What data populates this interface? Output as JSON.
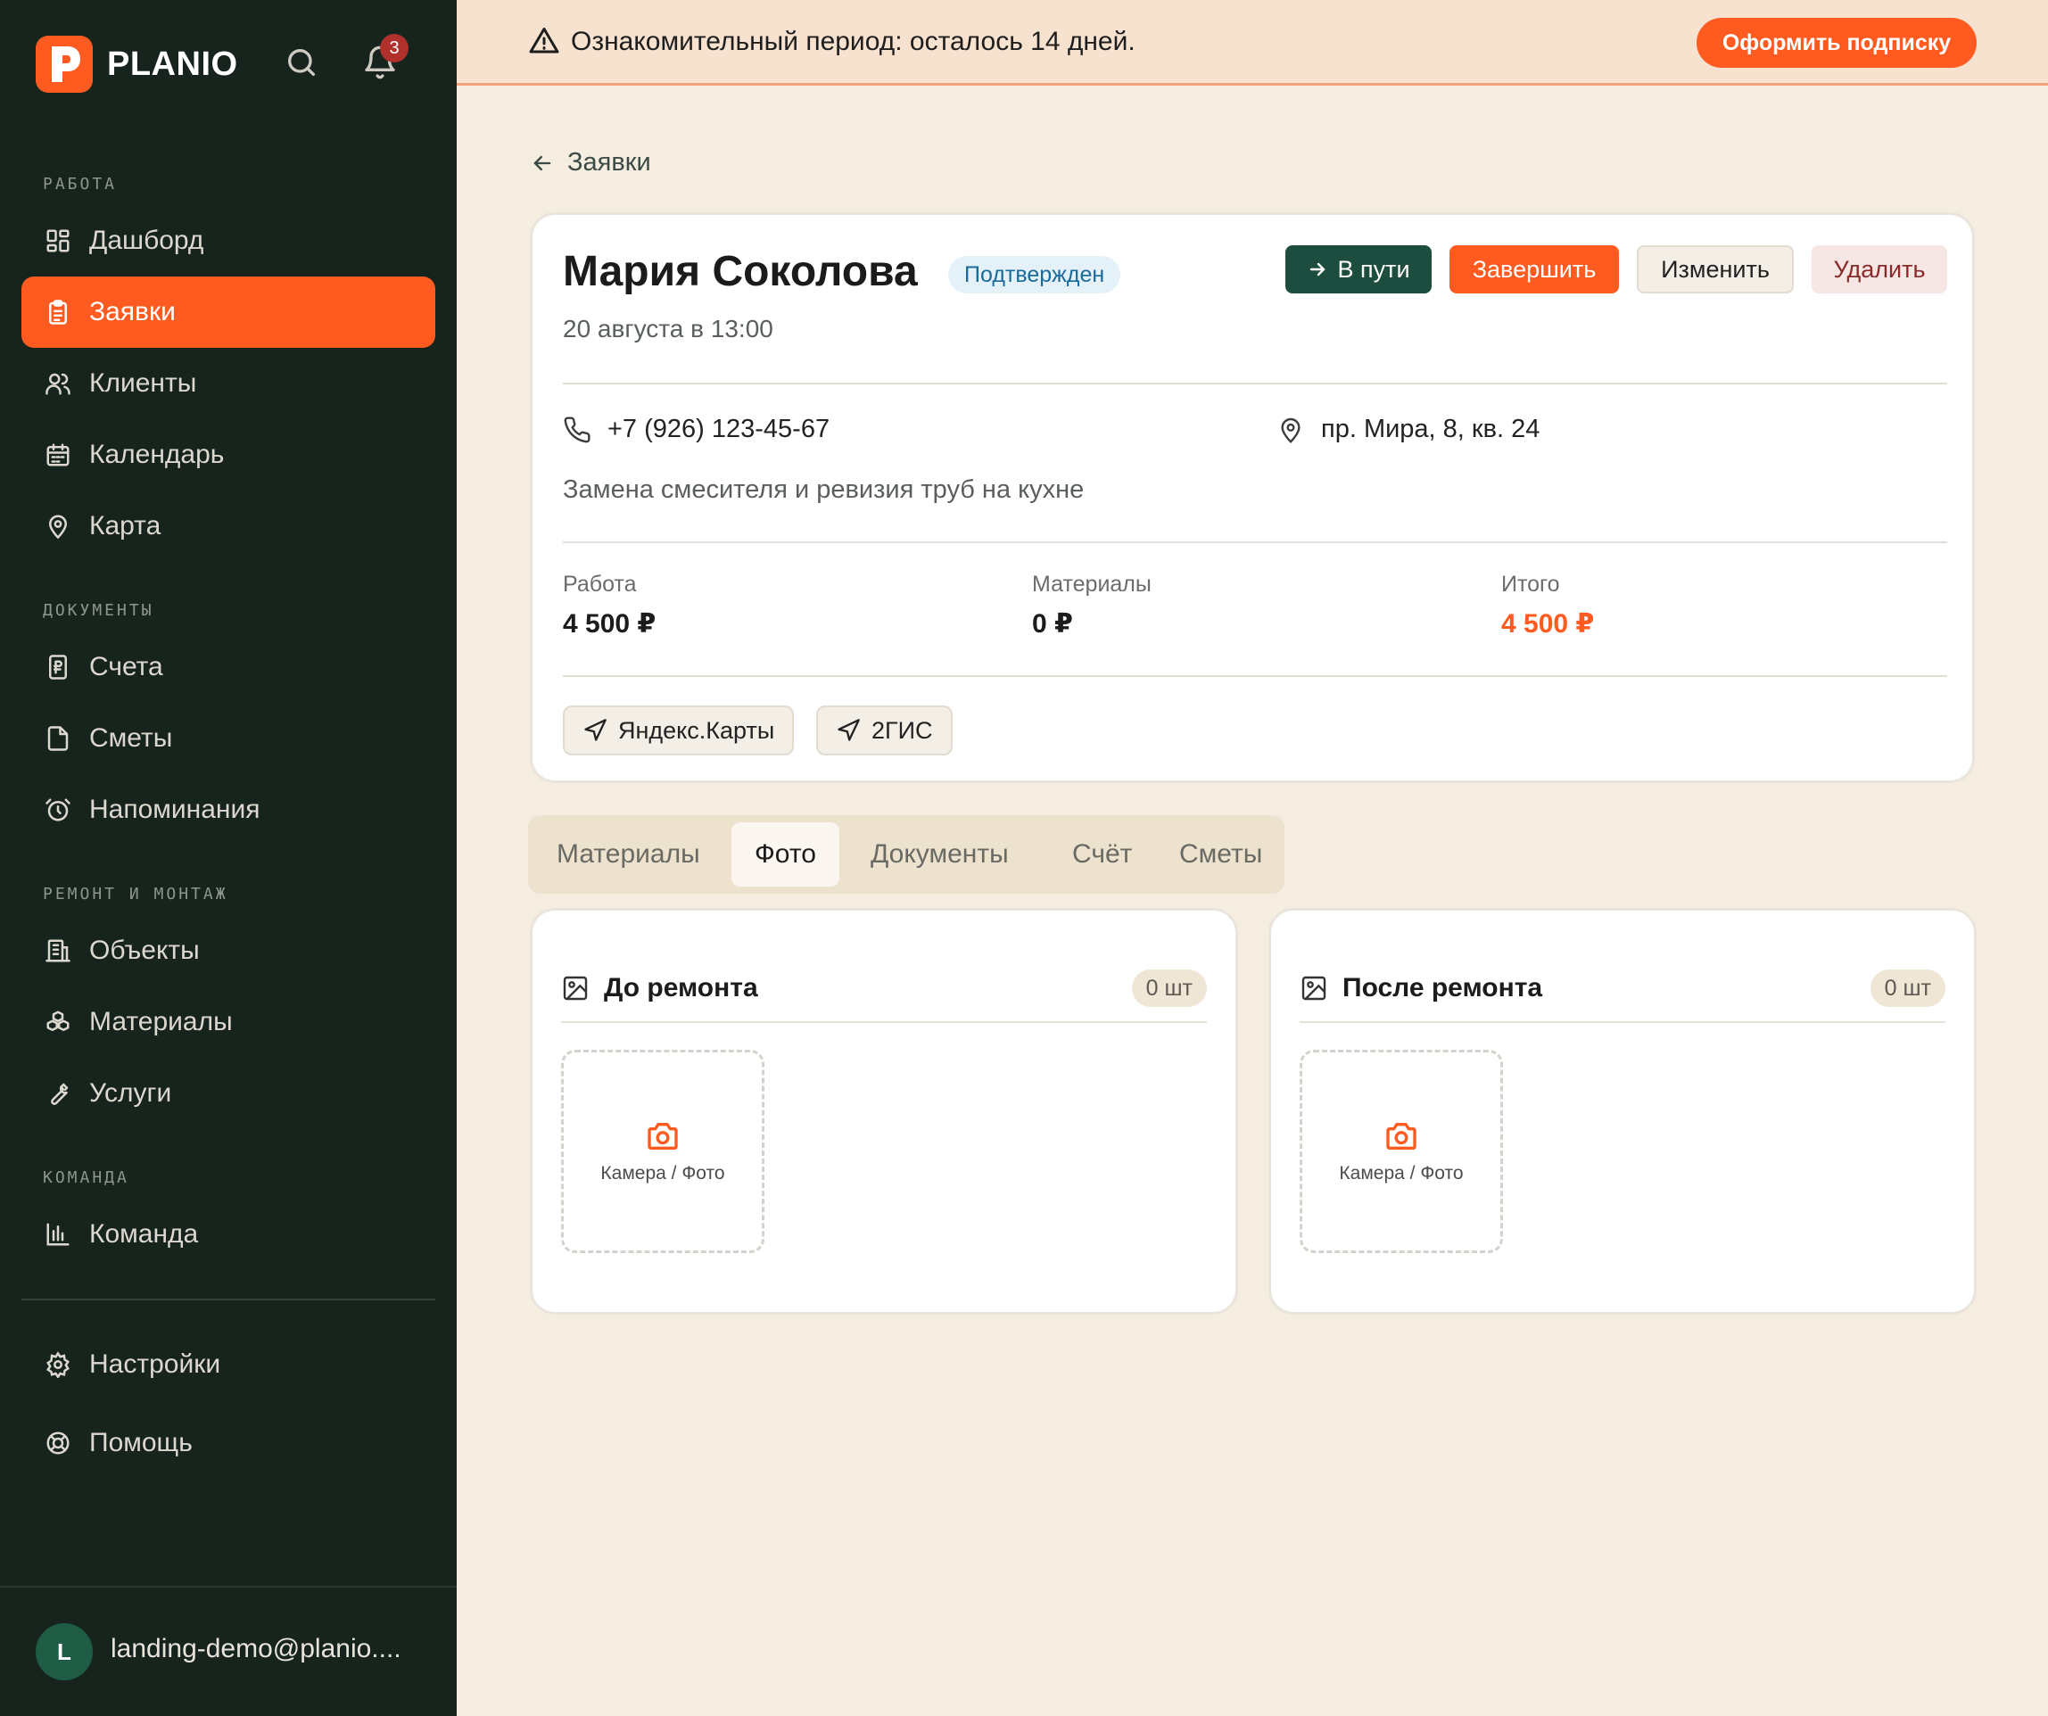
{
  "app": {
    "name": "PLANIO",
    "logo_letter": "P",
    "notifications_count": "3",
    "accent_color": "#ff5a1f",
    "sidebar_color": "#17241e"
  },
  "sidebar": {
    "sections": [
      {
        "label": "РАБОТА"
      },
      {
        "label": "ДОКУМЕНТЫ"
      },
      {
        "label": "РЕМОНТ И МОНТАЖ"
      },
      {
        "label": "КОМАНДА"
      }
    ],
    "items": [
      {
        "label": "Дашборд",
        "icon": "dashboard-icon"
      },
      {
        "label": "Заявки",
        "icon": "clipboard-icon",
        "active": true
      },
      {
        "label": "Клиенты",
        "icon": "users-icon"
      },
      {
        "label": "Календарь",
        "icon": "calendar-icon"
      },
      {
        "label": "Карта",
        "icon": "map-pin-icon"
      },
      {
        "label": "Счета",
        "icon": "receipt-icon"
      },
      {
        "label": "Сметы",
        "icon": "file-icon"
      },
      {
        "label": "Напоминания",
        "icon": "alarm-icon"
      },
      {
        "label": "Объекты",
        "icon": "building-icon"
      },
      {
        "label": "Материалы",
        "icon": "boxes-icon"
      },
      {
        "label": "Услуги",
        "icon": "wrench-icon"
      },
      {
        "label": "Команда",
        "icon": "chart-icon"
      },
      {
        "label": "Настройки",
        "icon": "gear-icon"
      },
      {
        "label": "Помощь",
        "icon": "lifebuoy-icon"
      }
    ],
    "user": {
      "initial": "L",
      "email": "landing-demo@planio...."
    }
  },
  "banner": {
    "text": "Ознакомительный период: осталось 14 дней.",
    "button": "Оформить подписку"
  },
  "breadcrumb": {
    "back_label": "Заявки"
  },
  "order": {
    "client_name": "Мария Соколова",
    "status": "Подтвержден",
    "date": "20 августа в 13:00",
    "actions": {
      "en_route": "В пути",
      "complete": "Завершить",
      "edit": "Изменить",
      "delete": "Удалить"
    },
    "phone": "+7 (926) 123-45-67",
    "address": "пр. Мира, 8, кв. 24",
    "description": "Замена смесителя и ревизия труб на кухне",
    "prices": {
      "work_label": "Работа",
      "work_value": "4 500 ₽",
      "materials_label": "Материалы",
      "materials_value": "0 ₽",
      "total_label": "Итого",
      "total_value": "4 500 ₽"
    },
    "map_links": {
      "yandex": "Яндекс.Карты",
      "twogis": "2ГИС"
    }
  },
  "tabs": [
    {
      "label": "Материалы"
    },
    {
      "label": "Фото",
      "active": true
    },
    {
      "label": "Документы"
    },
    {
      "label": "Счёт"
    },
    {
      "label": "Сметы"
    }
  ],
  "photos": {
    "before": {
      "title": "До ремонта",
      "count": "0 шт",
      "upload_label": "Камера / Фото"
    },
    "after": {
      "title": "После ремонта",
      "count": "0 шт",
      "upload_label": "Камера / Фото"
    }
  }
}
